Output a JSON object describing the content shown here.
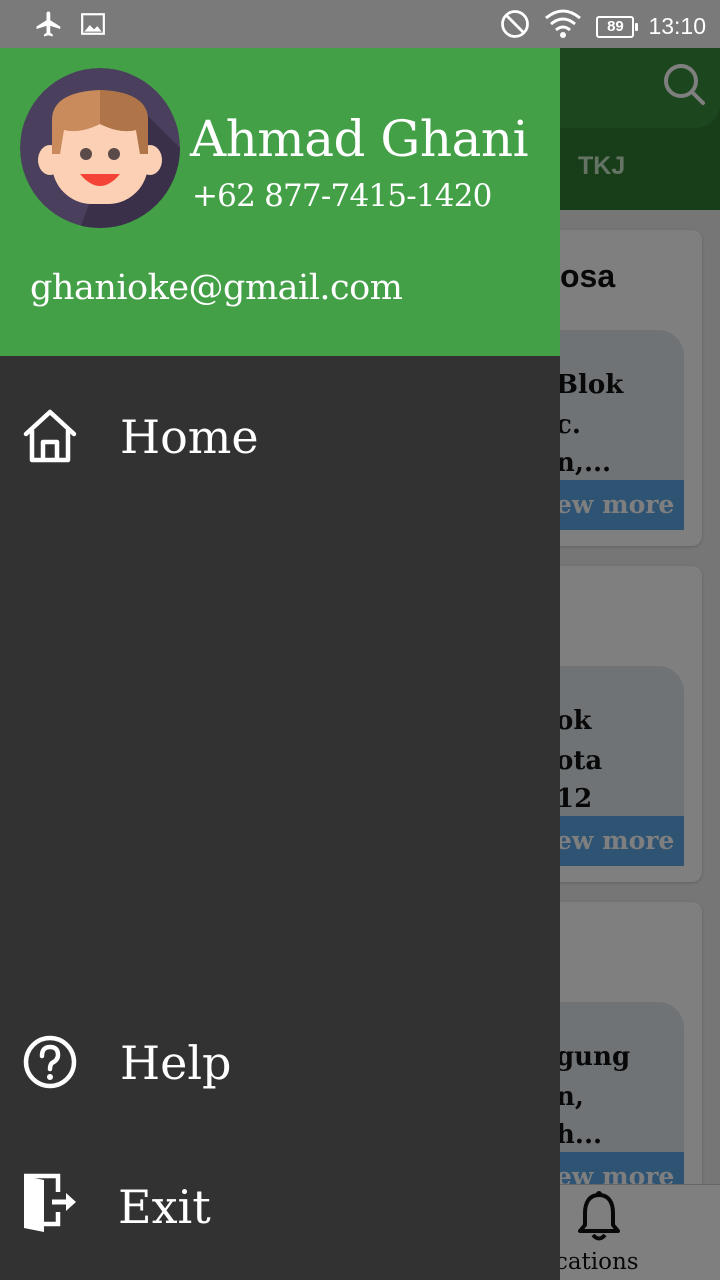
{
  "status_bar": {
    "battery": "89",
    "time": "13:10",
    "icons": [
      "airplane-icon",
      "image-icon",
      "do-not-disturb-icon",
      "wifi-icon",
      "battery-icon"
    ]
  },
  "background_app": {
    "tab_label": "TKJ",
    "cards": [
      {
        "heading": "osa",
        "lines": [
          "Blok",
          "c.",
          "n,..."
        ],
        "button": "ew more"
      },
      {
        "heading": "",
        "lines": [
          "ok",
          "ota",
          "12"
        ],
        "button": "ew more"
      },
      {
        "heading": "",
        "lines": [
          "gung",
          "n,",
          "h..."
        ],
        "button": "ew more"
      }
    ],
    "bottom_nav": {
      "label": "tifications",
      "icon": "bell-icon"
    }
  },
  "drawer": {
    "header": {
      "name": "Ahmad Ghani",
      "phone": "+62 877-7415-1420",
      "email": "ghanioke@gmail.com",
      "color": "#43a047"
    },
    "menu": {
      "home": {
        "label": "Home",
        "icon": "home-icon"
      },
      "help": {
        "label": "Help",
        "icon": "help-icon"
      },
      "exit": {
        "label": "Exit",
        "icon": "exit-icon"
      }
    },
    "background_color": "#323232"
  }
}
